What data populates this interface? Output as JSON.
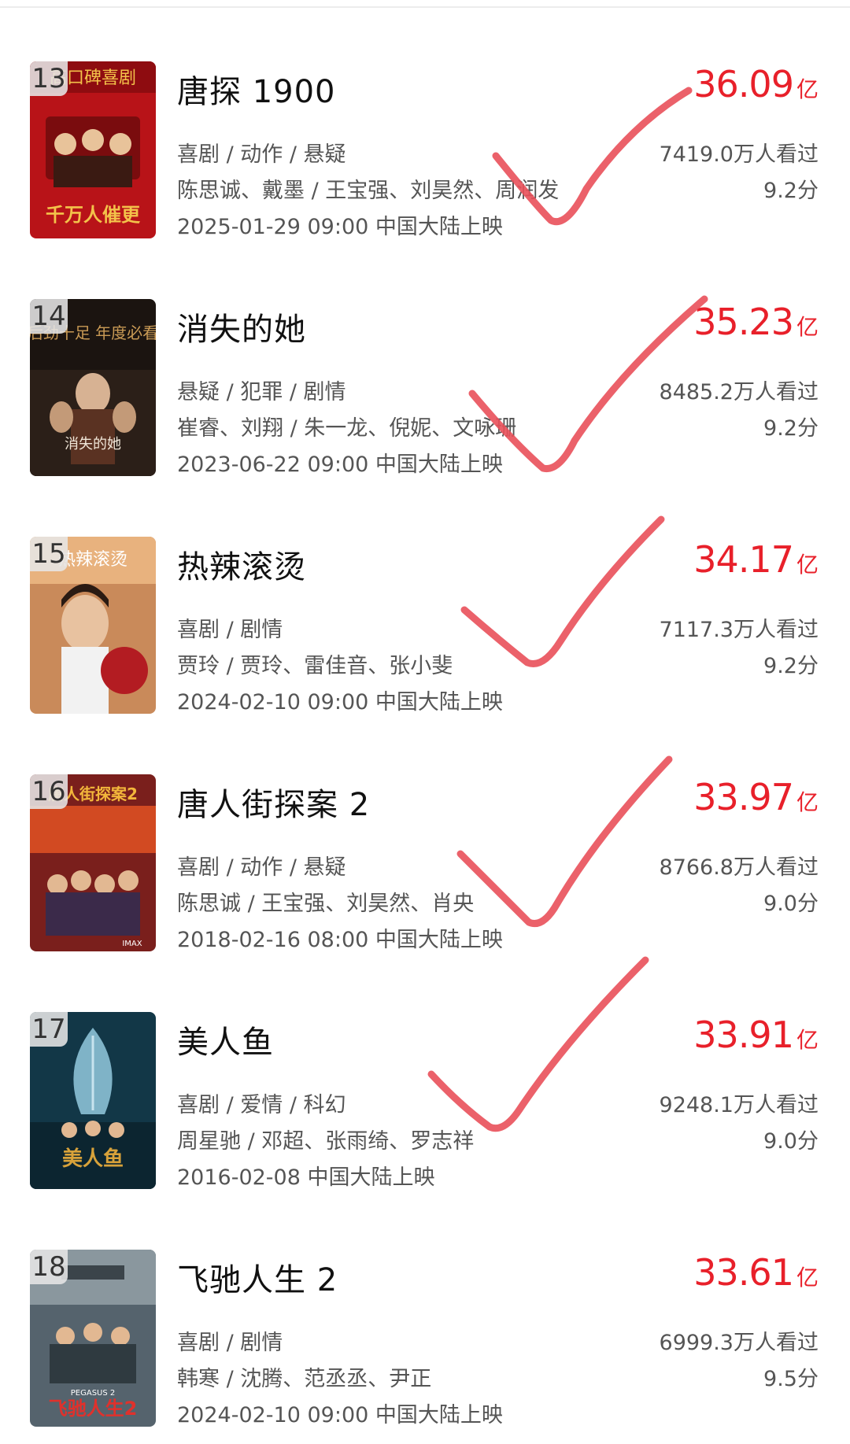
{
  "colors": {
    "accent_red": "#e8202a",
    "check_stroke": "#e9505a"
  },
  "movies": [
    {
      "rank": "13",
      "title": "唐探 1900",
      "genre": "喜剧 / 动作 / 悬疑",
      "cast": "陈思诚、戴墨 / 王宝强、刘昊然、周润发",
      "release": "2025-01-29 09:00 中国大陆上映",
      "gross": "36.09",
      "gross_unit": "亿",
      "viewers": "7419.0万人看过",
      "score": "9.2分",
      "poster": {
        "bg": "#b81318",
        "accent": "#f3c24a",
        "upper_text": "高口碑喜剧",
        "lower_text": "千万人催更"
      }
    },
    {
      "rank": "14",
      "title": "消失的她",
      "genre": "悬疑 / 犯罪 / 剧情",
      "cast": "崔睿、刘翔 / 朱一龙、倪妮、文咏珊",
      "release": "2023-06-22 09:00 中国大陆上映",
      "gross": "35.23",
      "gross_unit": "亿",
      "viewers": "8485.2万人看过",
      "score": "9.2分",
      "poster": {
        "bg": "#1b1410",
        "accent": "#c99a55",
        "upper_text": "后劲十足 年度必看",
        "lower_text": "消失的她"
      }
    },
    {
      "rank": "15",
      "title": "热辣滚烫",
      "genre": "喜剧 / 剧情",
      "cast": "贾玲 / 贾玲、雷佳音、张小斐",
      "release": "2024-02-10 09:00 中国大陆上映",
      "gross": "34.17",
      "gross_unit": "亿",
      "viewers": "7117.3万人看过",
      "score": "9.2分",
      "poster": {
        "bg": "#c98a5a",
        "accent": "#b31c22",
        "upper_text": "热辣滚烫",
        "lower_text": ""
      }
    },
    {
      "rank": "16",
      "title": "唐人街探案 2",
      "genre": "喜剧 / 动作 / 悬疑",
      "cast": "陈思诚 / 王宝强、刘昊然、肖央",
      "release": "2018-02-16 08:00 中国大陆上映",
      "gross": "33.97",
      "gross_unit": "亿",
      "viewers": "8766.8万人看过",
      "score": "9.0分",
      "poster": {
        "bg": "#7a1f1c",
        "accent": "#f2b63b",
        "upper_text": "唐人街探案2",
        "lower_text": "IMAX"
      }
    },
    {
      "rank": "17",
      "title": "美人鱼",
      "genre": "喜剧 / 爱情 / 科幻",
      "cast": "周星驰 / 邓超、张雨绮、罗志祥",
      "release": "2016-02-08 中国大陆上映",
      "gross": "33.91",
      "gross_unit": "亿",
      "viewers": "9248.1万人看过",
      "score": "9.0分",
      "poster": {
        "bg": "#123747",
        "accent": "#d8a23a",
        "upper_text": "",
        "lower_text": "美人鱼"
      }
    },
    {
      "rank": "18",
      "title": "飞驰人生 2",
      "genre": "喜剧 / 剧情",
      "cast": "韩寒 / 沈腾、范丞丞、尹正",
      "release": "2024-02-10 09:00 中国大陆上映",
      "gross": "33.61",
      "gross_unit": "亿",
      "viewers": "6999.3万人看过",
      "score": "9.5分",
      "poster": {
        "bg": "#55636d",
        "accent": "#e0312c",
        "upper_text": "PEGASUS 2",
        "lower_text": "飞驰人生2"
      }
    }
  ]
}
